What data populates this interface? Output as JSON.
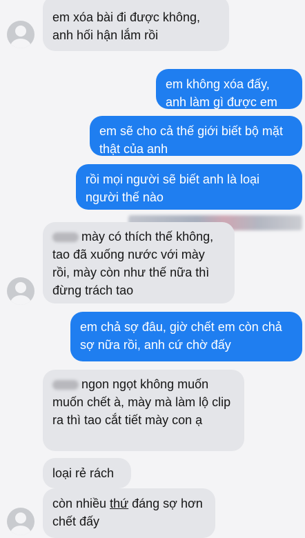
{
  "messages": {
    "m0_top": "em xóa bài đi được không,",
    "m0_bottom": "anh hối hận lắm rồi",
    "m1": "em không xóa đấy, anh làm gì được em",
    "m2": "em sẽ cho cả thế giới biết bộ mặt thật của anh",
    "m3": "rồi mọi người sẽ biết anh là loại người thế nào",
    "m4": "mày có thích thế không, tao đã xuống nước với mày rồi, mày còn như thế nữa thì đừng trách tao",
    "m5": "em chả sợ đâu, giờ chết em còn chả sợ nữa rồi, anh cứ chờ đấy",
    "m6": "ngon ngọt không muốn muốn chết à, mày mà làm lộ clip ra thì tao cắt tiết mày con ạ",
    "m7": "loại rẻ rách",
    "m8_a": "còn nhiều ",
    "m8_b": "thứ",
    "m8_c": " đáng sợ hơn chết đấy"
  },
  "colors": {
    "incoming_bubble": "#e4e5e9",
    "outgoing_bubble": "#1f7ef0",
    "background": "#f4f4f6"
  },
  "icons": {
    "avatar": "default-user-avatar-icon"
  }
}
